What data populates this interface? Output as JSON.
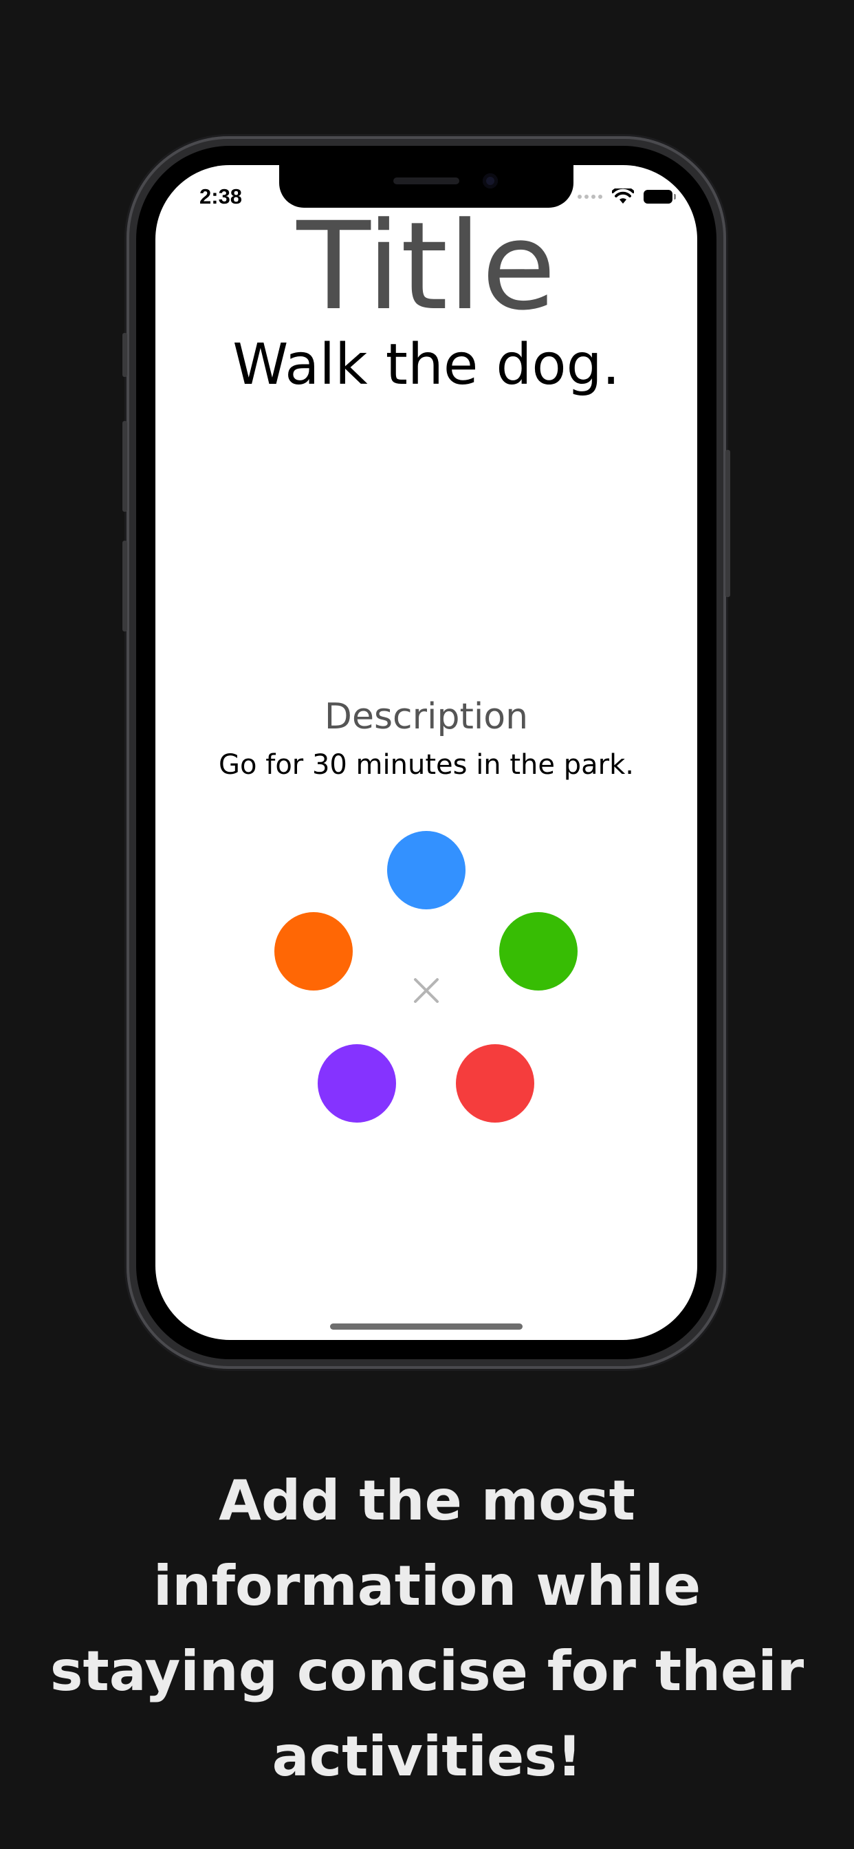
{
  "status_bar": {
    "time": "2:38",
    "icons": [
      "cellular-signal-icon",
      "wifi-icon",
      "battery-icon"
    ]
  },
  "screen": {
    "title_label": "Title",
    "title_value": "Walk the dog.",
    "description_label": "Description",
    "description_value": "Go for 30 minutes in the park.",
    "color_options": [
      {
        "name": "blue",
        "color": "#3391FF"
      },
      {
        "name": "orange",
        "color": "#FF6705"
      },
      {
        "name": "green",
        "color": "#37BD04"
      },
      {
        "name": "purple",
        "color": "#8533FF"
      },
      {
        "name": "red",
        "color": "#F53D3D"
      }
    ],
    "close_icon": "close-icon"
  },
  "caption": {
    "lines": [
      "Add the most",
      "information while",
      "staying concise for their",
      "activities!"
    ]
  },
  "colors": {
    "background": "#141414",
    "screen_background": "#FFFFFF",
    "caption_text": "#ECECEC",
    "label_gray": "#555555"
  }
}
